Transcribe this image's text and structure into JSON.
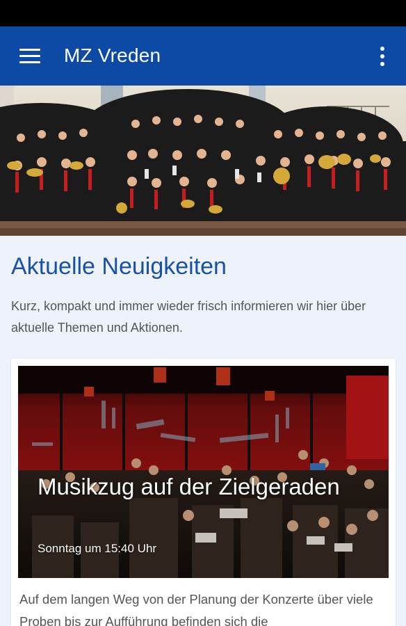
{
  "app": {
    "title": "MZ Vreden",
    "menu_icon": "hamburger-menu-icon",
    "more_icon": "more-vertical-icon",
    "primary_color": "#0d4aa5"
  },
  "hero": {
    "image_description_icon": "orchestra-group-photo"
  },
  "section": {
    "title": "Aktuelle Neuigkeiten",
    "intro": "Kurz, kompakt und immer wieder frisch informieren wir hier über aktuelle Themen und Aktionen."
  },
  "news": [
    {
      "title": "Musikzug auf der Zielgeraden",
      "date": "Sonntag um 15:40 Uhr",
      "excerpt": "Auf dem langen Weg von der Planung der Konzerte über viele Proben bis zur Aufführung befinden sich die"
    }
  ]
}
